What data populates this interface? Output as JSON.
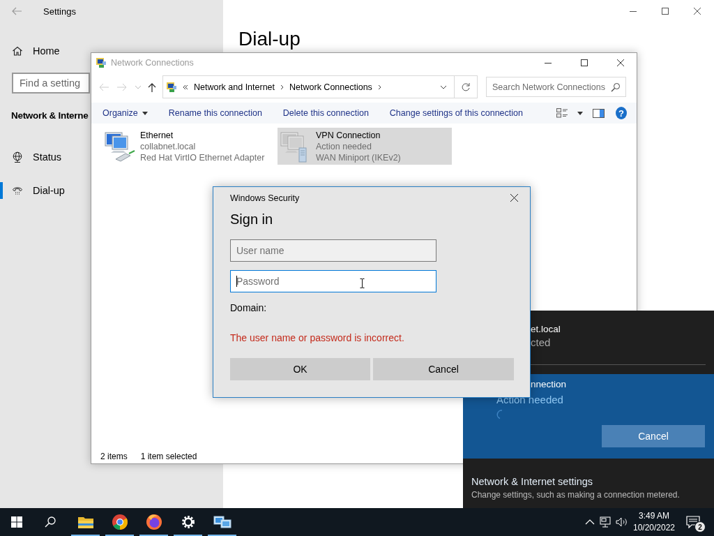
{
  "settings_window": {
    "title": "Settings",
    "heading": "Dial-up",
    "home": {
      "label": "Home"
    },
    "search": {
      "placeholder": "Find a setting"
    },
    "section": "Network & Interne",
    "nav": [
      {
        "kind": "status",
        "label": "Status",
        "selected": false
      },
      {
        "kind": "dialup",
        "label": "Dial-up",
        "selected": true
      }
    ]
  },
  "network_connections": {
    "title": "Network Connections",
    "breadcrumb": [
      "Network and Internet",
      "Network Connections"
    ],
    "search": {
      "placeholder": "Search Network Connections"
    },
    "toolbar": [
      {
        "label": "Organize",
        "dropdown": true
      },
      {
        "label": "Rename this connection",
        "dropdown": false
      },
      {
        "label": "Delete this connection",
        "dropdown": false
      },
      {
        "label": "Change settings of this connection",
        "dropdown": false
      }
    ],
    "help": "?",
    "connections": [
      {
        "kind": "ethernet",
        "name": "Ethernet",
        "status": "collabnet.local",
        "device": "Red Hat VirtIO Ethernet Adapter",
        "selected": false
      },
      {
        "kind": "vpn",
        "name": "VPN Connection",
        "status": "Action needed",
        "device": "WAN Miniport (IKEv2)",
        "selected": true
      }
    ],
    "status_bar": [
      "2 items",
      "1 item selected"
    ]
  },
  "sign_in_dialog": {
    "title": "Windows Security",
    "heading": "Sign in",
    "fields": [
      {
        "placeholder": "User name",
        "focused": false
      },
      {
        "placeholder": "Password",
        "focused": true
      }
    ],
    "domain_label": "Domain:",
    "error": "The user name or password is incorrect.",
    "buttons": [
      "OK",
      "Cancel"
    ]
  },
  "network_flyout": {
    "ethernet": {
      "name": "et.local",
      "status": "cted"
    },
    "vpn": {
      "name": "nnection",
      "status": "Action needed",
      "button": "Cancel"
    },
    "settings_link": "Network & Internet settings",
    "settings_hint": "Change settings, such as making a connection metered."
  },
  "taskbar": {
    "apps": [
      {
        "kind": "explorer",
        "running": true
      },
      {
        "kind": "chrome",
        "running": true
      },
      {
        "kind": "firefox",
        "running": true
      },
      {
        "kind": "settings",
        "running": true
      },
      {
        "kind": "network",
        "running": true
      }
    ],
    "time": "3:49 AM",
    "date": "10/20/2022",
    "notification_count": "2"
  }
}
